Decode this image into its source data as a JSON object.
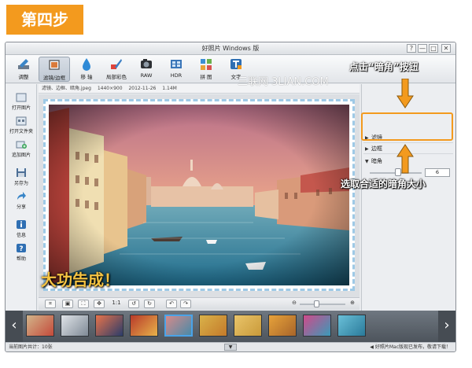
{
  "step_badge": "第四步",
  "window": {
    "title": "好照片 Windows 版",
    "controls": [
      "?",
      "—",
      "□",
      "✕"
    ]
  },
  "toolbar": {
    "tools": [
      {
        "label": "调整",
        "icon": "adjust-icon"
      },
      {
        "label": "滤镜/边框",
        "icon": "filter-frame-icon",
        "active": true
      },
      {
        "label": "移 轴",
        "icon": "tilt-shift-icon"
      },
      {
        "label": "局部彩色",
        "icon": "partial-color-icon"
      },
      {
        "label": "RAW",
        "icon": "raw-icon"
      },
      {
        "label": "HDR",
        "icon": "hdr-icon"
      },
      {
        "label": "拼 图",
        "icon": "collage-icon"
      },
      {
        "label": "文字",
        "icon": "text-icon"
      }
    ]
  },
  "sidebar": {
    "items": [
      {
        "label": "打开图片",
        "icon": "open-image-icon"
      },
      {
        "label": "打开文件夹",
        "icon": "open-folder-icon"
      },
      {
        "label": "追加图片",
        "icon": "add-image-icon"
      },
      {
        "label": "另存为",
        "icon": "save-as-icon"
      },
      {
        "label": "分享",
        "icon": "share-icon"
      },
      {
        "label": "信息",
        "icon": "info-icon"
      },
      {
        "label": "帮助",
        "icon": "help-icon"
      }
    ]
  },
  "infobar": {
    "filename": "滤镜、边框、暗角.jpeg",
    "dimensions": "1440×900",
    "date": "2012-11-26",
    "size": "1.14M"
  },
  "right_panel": {
    "rows": [
      {
        "label": "滤镜"
      },
      {
        "label": "边框"
      },
      {
        "label": "暗角",
        "expanded": true
      }
    ],
    "vignette_value": "6",
    "vignette_level": 0.55
  },
  "bottombar": {
    "ratio_label": "1:1",
    "zoom_level": 0.35
  },
  "statusbar": {
    "left": "当前图片共计：10张",
    "right": "好照片Mac版现已发布，敬请下载！"
  },
  "overlays": {
    "watermark": "三联网 3LIAN.COM",
    "callout_top_pre": "点击“",
    "callout_top_word": "暗角",
    "callout_top_post": "”按钮",
    "callout_mid": "选取合适的暗角大小",
    "callout_done": "大功告成！"
  },
  "colors": {
    "badge": "#f39a1e",
    "arrow": "#f39a1e",
    "selection": "#4aa3e8"
  }
}
